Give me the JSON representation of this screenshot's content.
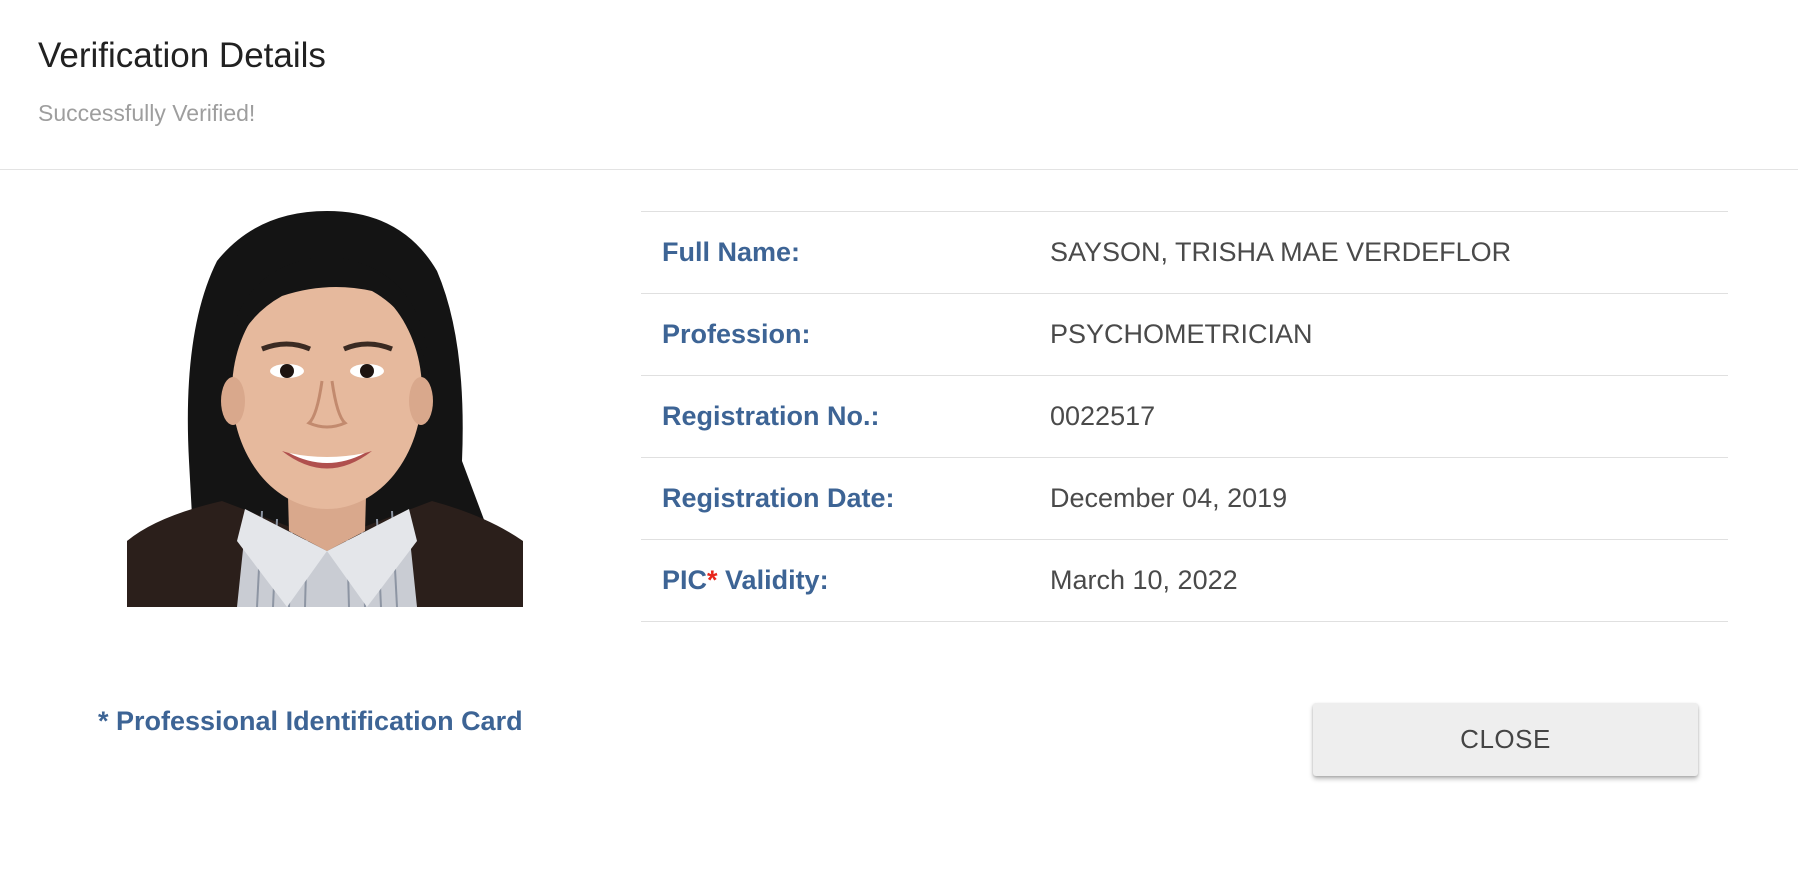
{
  "header": {
    "title": "Verification Details",
    "subtitle": "Successfully Verified!"
  },
  "photo": {
    "alt": "Registrant photo"
  },
  "details": {
    "full_name": {
      "label": "Full Name:",
      "value": "SAYSON, TRISHA MAE VERDEFLOR"
    },
    "profession": {
      "label": "Profession:",
      "value": "PSYCHOMETRICIAN"
    },
    "registration_no": {
      "label": "Registration No.:",
      "value": "0022517"
    },
    "registration_date": {
      "label": "Registration Date:",
      "value": "December 04, 2019"
    },
    "pic_validity": {
      "label_prefix": "PIC",
      "label_star": "*",
      "label_suffix": " Validity:",
      "value": "March 10, 2022"
    }
  },
  "footer": {
    "footnote": "* Professional Identification Card",
    "close_label": "CLOSE"
  },
  "colors": {
    "label_blue": "#3d6495",
    "asterisk_red": "#e8261b",
    "value_gray": "#4a4a4a",
    "subtitle_gray": "#9e9e9e",
    "button_bg": "#eeeeee"
  }
}
